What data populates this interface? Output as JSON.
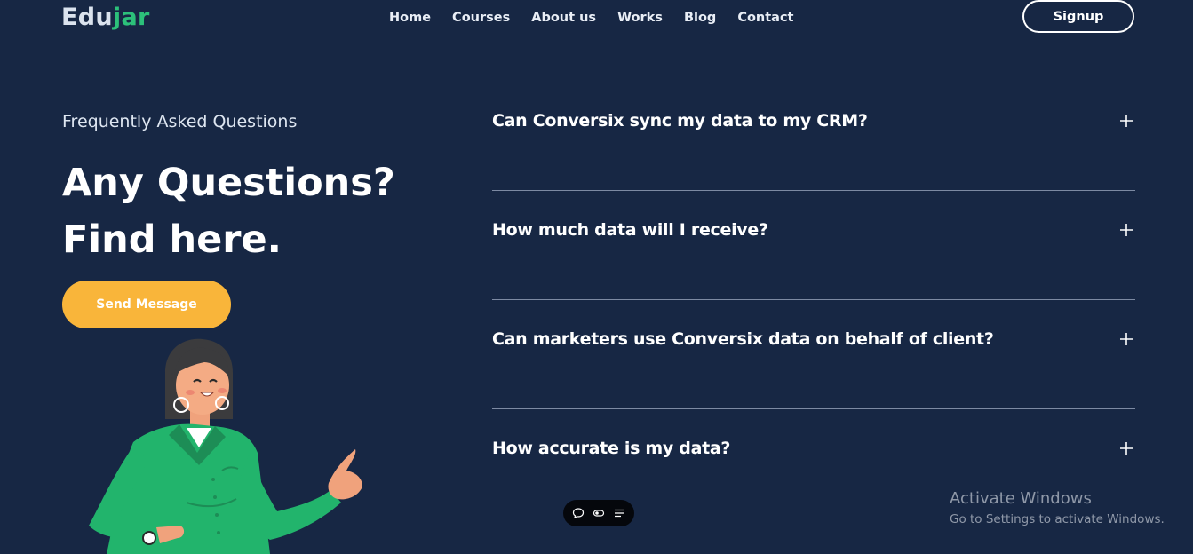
{
  "header": {
    "logo_part1": "Edu",
    "logo_part2": "jar",
    "nav": [
      "Home",
      "Courses",
      "About us",
      "Works",
      "Blog",
      "Contact"
    ],
    "signup_label": "Signup"
  },
  "hero": {
    "eyebrow": "Frequently Asked Questions",
    "headline_line1": "Any Questions?",
    "headline_line2": "Find here.",
    "cta_label": "Send Message"
  },
  "faq": [
    {
      "question": "Can Conversix sync my data to my CRM?"
    },
    {
      "question": "How much data will I receive?"
    },
    {
      "question": "Can marketers use Conversix data on behalf of client?"
    },
    {
      "question": "How accurate is my data?"
    }
  ],
  "floating_toolbar": {
    "icons": [
      "chat-icon",
      "toggle-icon",
      "menu-icon"
    ]
  },
  "watermark": {
    "title": "Activate Windows",
    "subtitle": "Go to Settings to activate Windows."
  },
  "colors": {
    "background": "#172744",
    "logo_accent": "#2cc07a",
    "cta": "#f9b53a",
    "shirt": "#22b46c"
  }
}
